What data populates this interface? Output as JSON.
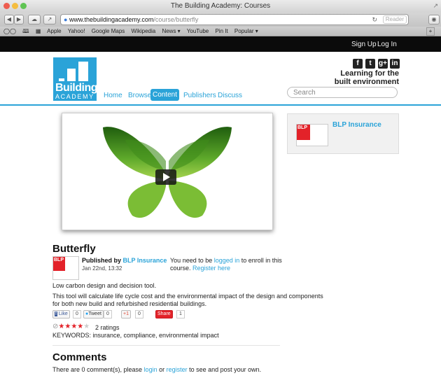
{
  "browser": {
    "window_title": "The Building Academy: Courses",
    "url_domain": "www.thebuildingacademy.com",
    "url_path": "/course/butterfly",
    "reader_label": "Reader",
    "bookmarks": [
      "Apple",
      "Yahoo!",
      "Google Maps",
      "Wikipedia",
      "News ▾",
      "YouTube",
      "Pin It",
      "Popular ▾"
    ]
  },
  "topbar": {
    "signup": "Sign Up",
    "login": "Log In"
  },
  "logo": {
    "line1": "Building",
    "line2": "ACADEMY"
  },
  "nav": {
    "home": "Home",
    "browse": "Browse",
    "content": "Content",
    "publishers": "Publishers",
    "discuss": "Discuss"
  },
  "tagline": {
    "line1": "Learning for the",
    "line2": "built environment"
  },
  "search": {
    "placeholder": "Search"
  },
  "sidebar": {
    "publisher": "BLP Insurance"
  },
  "blp_logo_text": "BLP",
  "course": {
    "title": "Butterfly",
    "published_prefix": "Published by ",
    "publisher": "BLP Insurance",
    "date": "Jan 22nd, 13:32",
    "enroll_pre": "You need to be ",
    "enroll_link": "logged in",
    "enroll_post": " to enroll in this",
    "enroll_line2_pre": "course. ",
    "register_here": "Register here",
    "summary": "Low carbon design and decision tool.",
    "desc_line1": "This tool will calculate life cycle cost and the environmental impact of the design and components",
    "desc_line2": "for both new build and refurbished residential buildings.",
    "share": {
      "like": "Like",
      "like_count": "0",
      "tweet": "Tweet",
      "tweet_count": "0",
      "gplus": "+1",
      "gplus_count": "0",
      "share": "Share",
      "share_count": "1"
    },
    "rating_stars": 4,
    "ratings": "2 ratings",
    "keywords": "KEYWORDS: insurance, compliance, environmental impact"
  },
  "comments": {
    "heading": "Comments",
    "pre": "There are 0 comment(s), please ",
    "login": "login",
    "or": " or ",
    "register": "register",
    "post": " to see and post your own."
  },
  "colors": {
    "brand_blue": "#2aa3d8",
    "black_bar": "#0b0b0b",
    "blp_red": "#e32229"
  }
}
